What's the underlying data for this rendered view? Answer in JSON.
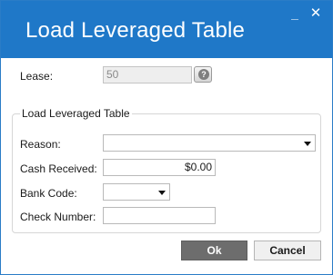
{
  "dialog": {
    "title": "Load Leveraged Table",
    "minimize_glyph": "_",
    "close_glyph": "✕"
  },
  "lease": {
    "label": "Lease:",
    "value": "50",
    "help_glyph": "?"
  },
  "group": {
    "title": "Load Leveraged Table",
    "reason": {
      "label": "Reason:",
      "value": ""
    },
    "cash_received": {
      "label": "Cash Received:",
      "value": "$0.00"
    },
    "bank_code": {
      "label": "Bank Code:",
      "value": ""
    },
    "check_number": {
      "label": "Check Number:",
      "value": ""
    }
  },
  "buttons": {
    "ok_label": "Ok",
    "cancel_label": "Cancel"
  },
  "colors": {
    "titlebar": "#1f78c8",
    "ok_button": "#6d6d6d"
  }
}
